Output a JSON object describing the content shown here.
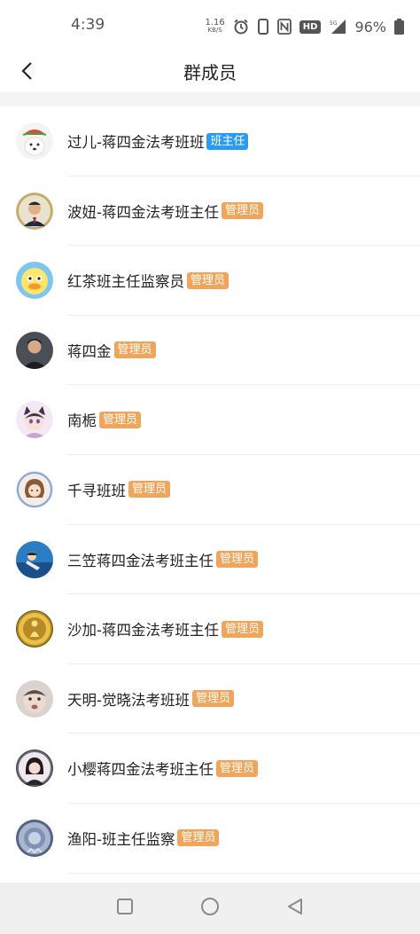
{
  "status_bar": {
    "time": "4:39",
    "net_speed_value": "1.16",
    "net_speed_unit": "KB/S",
    "hd_label": "HD",
    "battery_percent": "96%",
    "icons": [
      "alarm-icon",
      "vibrate-icon",
      "nfc-icon",
      "signal-icon",
      "battery-icon"
    ]
  },
  "nav": {
    "title": "群成员",
    "back_icon": "chevron-left-icon"
  },
  "colors": {
    "admin_tag": "#f0a55a",
    "head_teacher_tag": "#2b9af3"
  },
  "members": [
    {
      "name": "过儿-蒋四金法考班班",
      "tag": "班主任",
      "tag_type": "head",
      "avatar": "dog-watermelon-avatar"
    },
    {
      "name": "波妞-蒋四金法考班主任",
      "tag": "管理员",
      "tag_type": "admin",
      "avatar": "man-suit-avatar"
    },
    {
      "name": "红茶班主任监察员",
      "tag": "管理员",
      "tag_type": "admin",
      "avatar": "duck-cartoon-avatar"
    },
    {
      "name": "蒋四金",
      "tag": "管理员",
      "tag_type": "admin",
      "avatar": "man-portrait-avatar"
    },
    {
      "name": "南栀",
      "tag": "管理员",
      "tag_type": "admin",
      "avatar": "anime-cat-girl-avatar"
    },
    {
      "name": "千寻班班",
      "tag": "管理员",
      "tag_type": "admin",
      "avatar": "anime-girl-avatar"
    },
    {
      "name": "三笠蒋四金法考班主任",
      "tag": "管理员",
      "tag_type": "admin",
      "avatar": "ocean-character-avatar"
    },
    {
      "name": "沙加-蒋四金法考班主任",
      "tag": "管理员",
      "tag_type": "admin",
      "avatar": "golden-figure-avatar"
    },
    {
      "name": "天明-觉晓法考班班",
      "tag": "管理员",
      "tag_type": "admin",
      "avatar": "blurry-face-avatar"
    },
    {
      "name": "小樱蒋四金法考班主任",
      "tag": "管理员",
      "tag_type": "admin",
      "avatar": "girl-photo-avatar"
    },
    {
      "name": "渔阳-班主任监察",
      "tag": "管理员",
      "tag_type": "admin",
      "avatar": "blue-badge-avatar"
    }
  ],
  "bottom_nav": {
    "icons": [
      "recent-apps-square-icon",
      "home-circle-icon",
      "back-triangle-icon"
    ]
  }
}
